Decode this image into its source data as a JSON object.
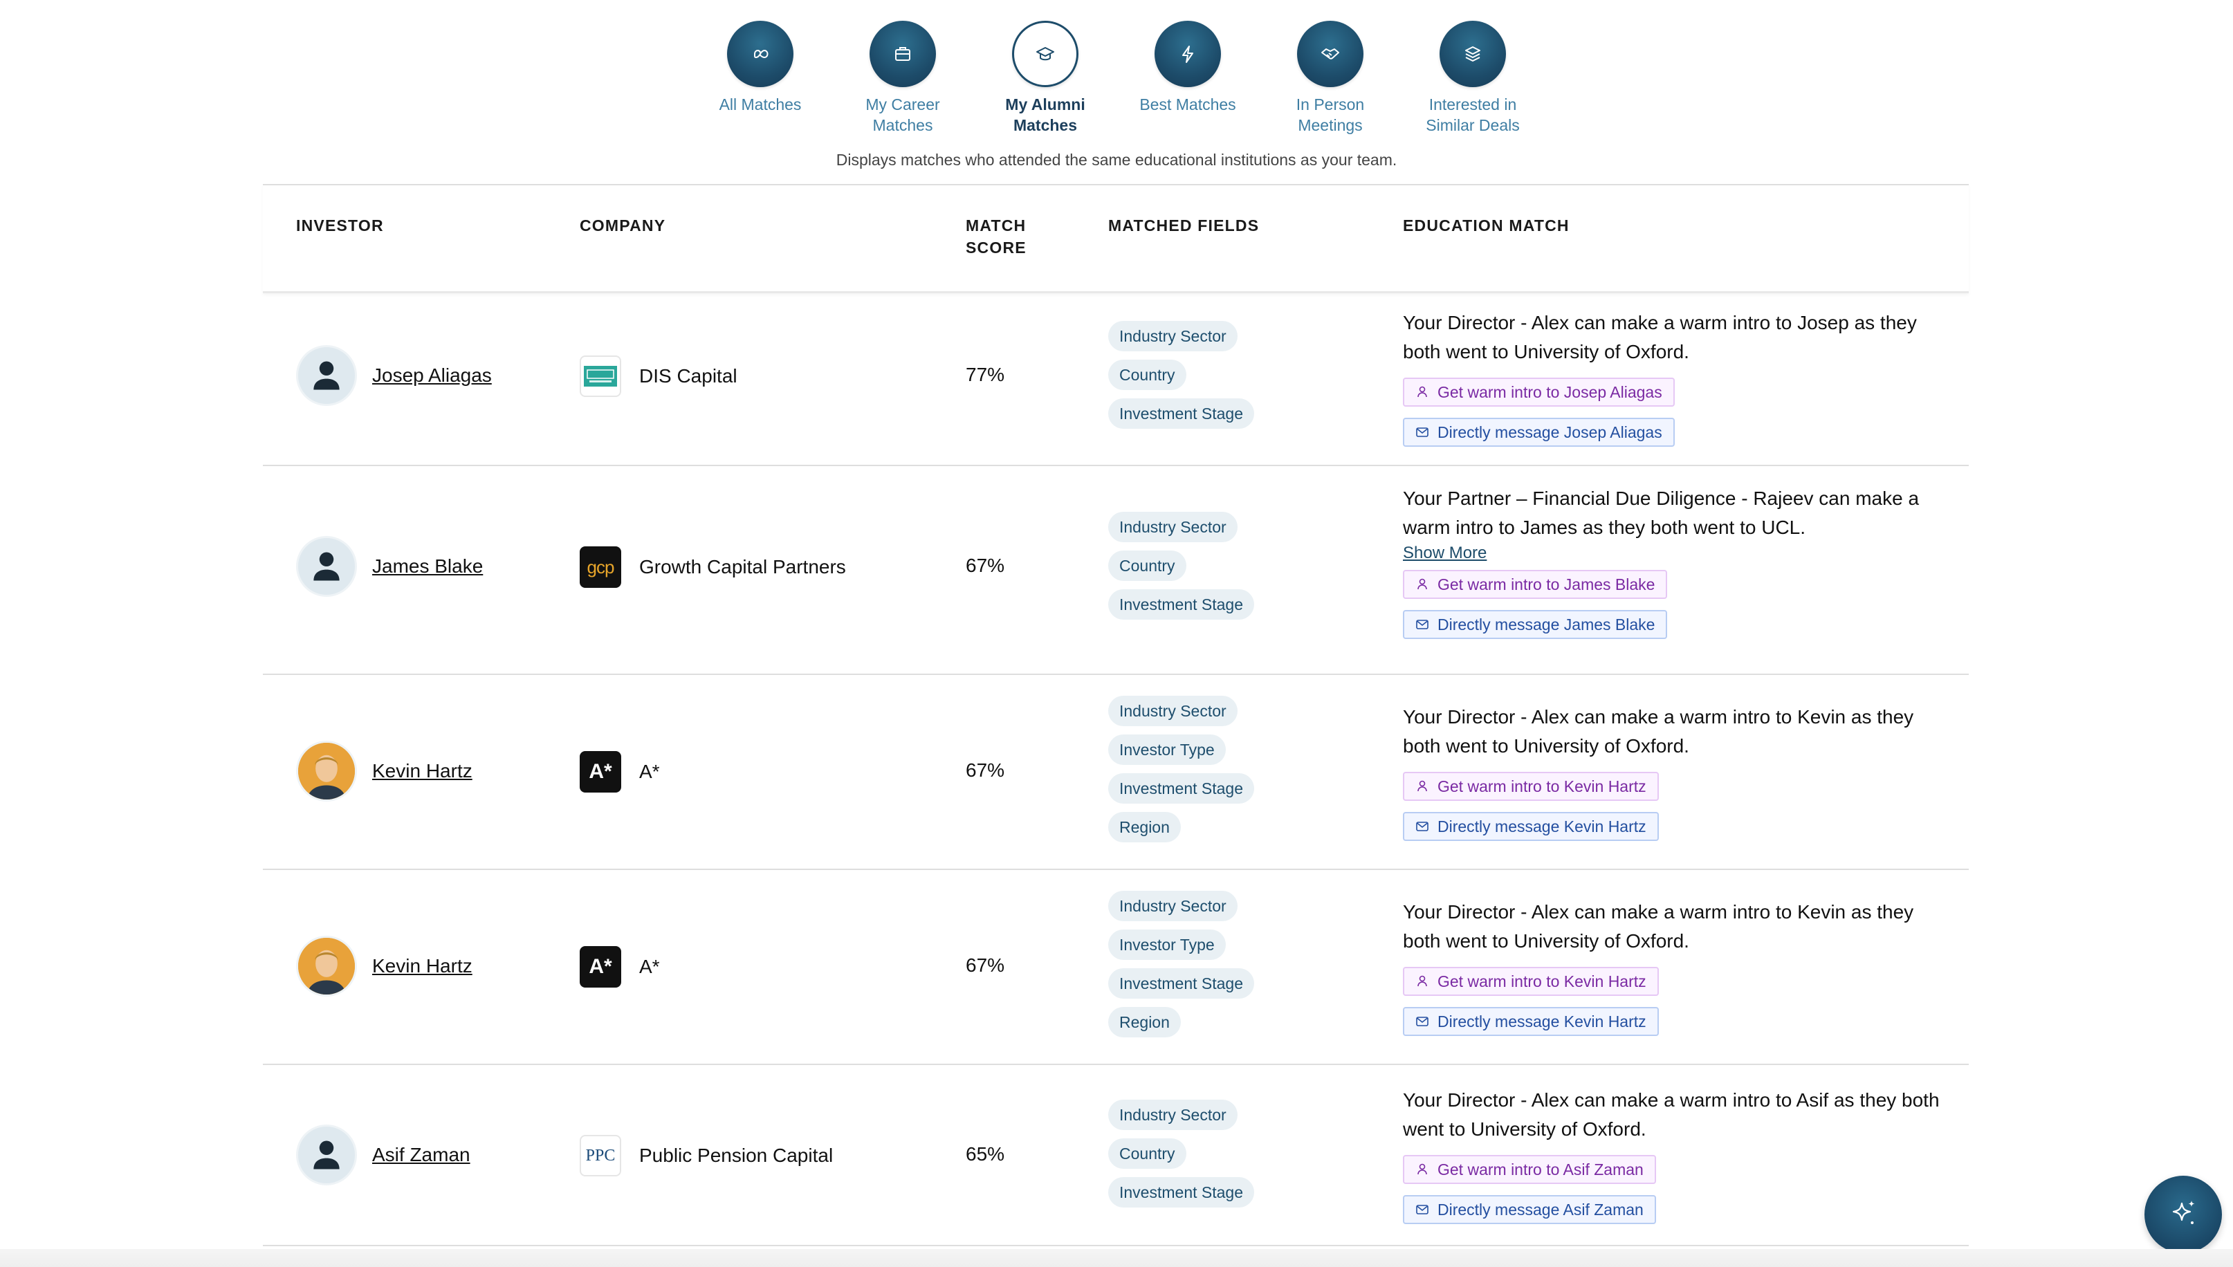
{
  "tabs": [
    {
      "label": "All Matches",
      "icon": "infinity-icon",
      "active": false
    },
    {
      "label": "My Career\nMatches",
      "icon": "briefcase-icon",
      "active": false
    },
    {
      "label": "My Alumni\nMatches",
      "icon": "graduation-cap-icon",
      "active": true
    },
    {
      "label": "Best Matches",
      "icon": "lightning-icon",
      "active": false
    },
    {
      "label": "In Person\nMeetings",
      "icon": "handshake-icon",
      "active": false
    },
    {
      "label": "Interested in\nSimilar Deals",
      "icon": "layers-icon",
      "active": false
    }
  ],
  "subtitle": "Displays matches who attended the same educational institutions as your team.",
  "table": {
    "headers": {
      "investor": "INVESTOR",
      "company": "COMPANY",
      "match_score": "MATCH\nSCORE",
      "matched_fields": "MATCHED FIELDS",
      "education_match": "EDUCATION MATCH"
    },
    "rows": [
      {
        "investor": "Josep Aliagas",
        "avatar": "person-placeholder-icon",
        "company": "DIS Capital",
        "logo": "dis-capital-logo",
        "score": "77%",
        "fields": [
          "Industry Sector",
          "Country",
          "Investment Stage"
        ],
        "education": "Your Director - Alex can make a warm intro to Josep as they both went to University of Oxford.",
        "show_more": "",
        "intro_btn": "Get warm intro to Josep Aliagas",
        "msg_btn": "Directly message Josep Aliagas"
      },
      {
        "investor": "James Blake",
        "avatar": "person-placeholder-icon",
        "company": "Growth Capital Partners",
        "logo": "gcp-logo",
        "score": "67%",
        "fields": [
          "Industry Sector",
          "Country",
          "Investment Stage"
        ],
        "education": "Your Partner – Financial Due Diligence - Rajeev can make a warm intro to James as they both went to UCL.",
        "show_more": "Show More",
        "intro_btn": "Get warm intro to James Blake",
        "msg_btn": "Directly message James Blake"
      },
      {
        "investor": "Kevin Hartz",
        "avatar": "photo",
        "company": "A*",
        "logo": "a-star-logo",
        "score": "67%",
        "fields": [
          "Industry Sector",
          "Investor Type",
          "Investment Stage",
          "Region"
        ],
        "education": "Your Director - Alex can make a warm intro to Kevin as they both went to University of Oxford.",
        "show_more": "",
        "intro_btn": "Get warm intro to Kevin Hartz",
        "msg_btn": "Directly message Kevin Hartz"
      },
      {
        "investor": "Kevin Hartz",
        "avatar": "photo",
        "company": "A*",
        "logo": "a-star-logo",
        "score": "67%",
        "fields": [
          "Industry Sector",
          "Investor Type",
          "Investment Stage",
          "Region"
        ],
        "education": "Your Director - Alex can make a warm intro to Kevin as they both went to University of Oxford.",
        "show_more": "",
        "intro_btn": "Get warm intro to Kevin Hartz",
        "msg_btn": "Directly message Kevin Hartz"
      },
      {
        "investor": "Asif Zaman",
        "avatar": "person-placeholder-icon",
        "company": "Public Pension Capital",
        "logo": "ppc-logo",
        "score": "65%",
        "fields": [
          "Industry Sector",
          "Country",
          "Investment Stage"
        ],
        "education": "Your Director - Alex can make a warm intro to Asif as they both went to University of Oxford.",
        "show_more": "",
        "intro_btn": "Get warm intro to Asif Zaman",
        "msg_btn": "Directly message Asif Zaman"
      }
    ]
  },
  "logo_text": {
    "gcp": "gcp",
    "a_star": "A*",
    "ppc": "PPC"
  },
  "colors": {
    "brand_dark": "#1d4c6a",
    "tab_label": "#3f7ea3",
    "chip_bg": "#e9f0f4",
    "intro_purple": "#7a2aa3",
    "message_blue": "#244fa0"
  },
  "fab_icon": "sparkle-icon"
}
